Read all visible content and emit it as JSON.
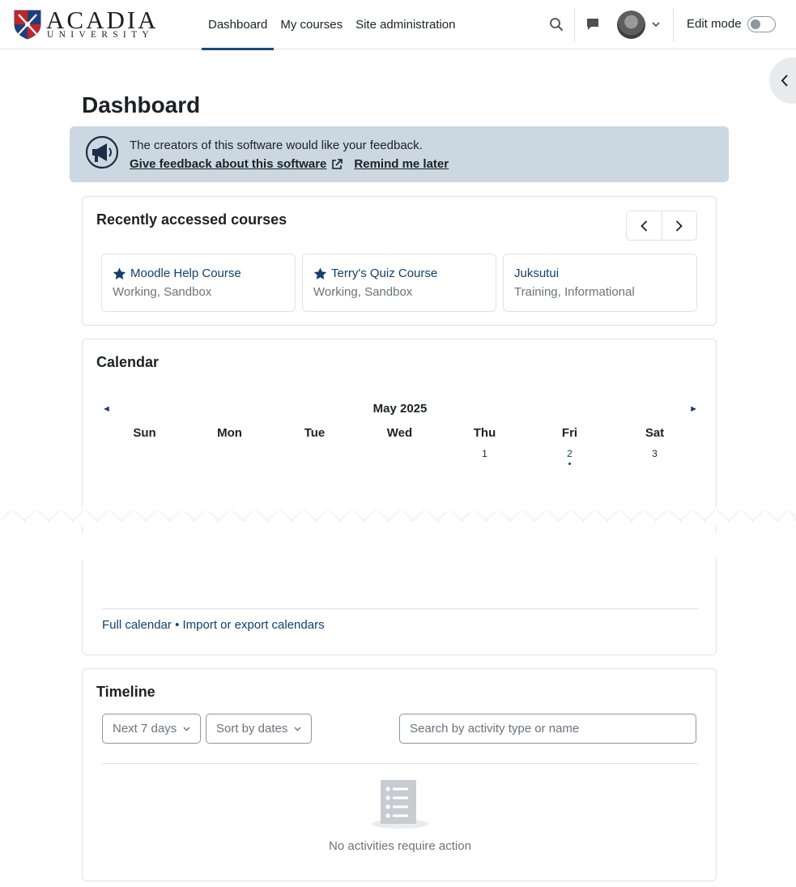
{
  "header": {
    "logo_word": "ACADIA",
    "logo_sub": "UNIVERSITY",
    "nav": [
      {
        "label": "Dashboard",
        "active": true
      },
      {
        "label": "My courses",
        "active": false
      },
      {
        "label": "Site administration",
        "active": false
      }
    ],
    "edit_mode_label": "Edit mode",
    "edit_mode_on": false
  },
  "page_title": "Dashboard",
  "feedback": {
    "message": "The creators of this software would like your feedback.",
    "give_feedback": "Give feedback about this software",
    "remind_later": "Remind me later"
  },
  "recent_courses": {
    "title": "Recently accessed courses",
    "courses": [
      {
        "name": "Moodle Help Course",
        "category": "Working, Sandbox",
        "starred": true
      },
      {
        "name": "Terry's Quiz Course",
        "category": "Working, Sandbox",
        "starred": true
      },
      {
        "name": "Juksutui",
        "category": "Training, Informational",
        "starred": false
      }
    ]
  },
  "calendar": {
    "title": "Calendar",
    "month": "May 2025",
    "weekdays": [
      "Sun",
      "Mon",
      "Tue",
      "Wed",
      "Thu",
      "Fri",
      "Sat"
    ],
    "first_row": [
      "",
      "",
      "",
      "",
      "1",
      "2",
      "3"
    ],
    "event_dates": [
      "2"
    ],
    "full_calendar": "Full calendar",
    "separator": "•",
    "import_export": "Import or export calendars"
  },
  "timeline": {
    "title": "Timeline",
    "range_filter": "Next 7 days",
    "sort_filter": "Sort by dates",
    "search_placeholder": "Search by activity type or name",
    "empty_message": "No activities require action"
  },
  "colors": {
    "accent": "#1a4b7a",
    "link": "#123f6b",
    "feedback_bg": "#cbd8e1",
    "border": "#dee2e6",
    "muted": "#6a737b"
  }
}
